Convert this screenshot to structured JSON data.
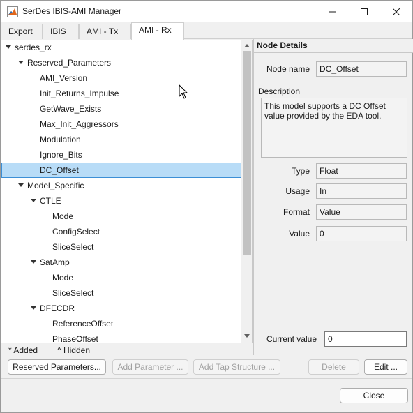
{
  "window": {
    "title": "SerDes IBIS-AMI Manager"
  },
  "tabs": [
    {
      "label": "Export"
    },
    {
      "label": "IBIS"
    },
    {
      "label": "AMI - Tx"
    },
    {
      "label": "AMI - Rx"
    }
  ],
  "active_tab": "AMI - Rx",
  "tree": {
    "rows": [
      {
        "label": "serdes_rx"
      },
      {
        "label": "Reserved_Parameters"
      },
      {
        "label": "AMI_Version"
      },
      {
        "label": "Init_Returns_Impulse"
      },
      {
        "label": "GetWave_Exists"
      },
      {
        "label": "Max_Init_Aggressors"
      },
      {
        "label": "Modulation"
      },
      {
        "label": "Ignore_Bits"
      },
      {
        "label": "DC_Offset"
      },
      {
        "label": "Model_Specific"
      },
      {
        "label": "CTLE"
      },
      {
        "label": "Mode"
      },
      {
        "label": "ConfigSelect"
      },
      {
        "label": "SliceSelect"
      },
      {
        "label": "SatAmp"
      },
      {
        "label": "Mode"
      },
      {
        "label": "SliceSelect"
      },
      {
        "label": "DFECDR"
      },
      {
        "label": "ReferenceOffset"
      },
      {
        "label": "PhaseOffset"
      }
    ],
    "selected": "DC_Offset"
  },
  "details": {
    "header": "Node Details",
    "node_name_label": "Node name",
    "node_name": "DC_Offset",
    "description_label": "Description",
    "description": "This model supports a DC Offset value provided by the EDA tool.",
    "type_label": "Type",
    "type": "Float",
    "usage_label": "Usage",
    "usage": "In",
    "format_label": "Format",
    "format": "Value",
    "value_label": "Value",
    "value": "0",
    "current_value_label": "Current value",
    "current_value": "0"
  },
  "legend": {
    "added": "* Added",
    "hidden": "^ Hidden"
  },
  "buttons": {
    "reserved_parameters": "Reserved Parameters...",
    "add_parameter": "Add Parameter ...",
    "add_tap_structure": "Add Tap Structure ...",
    "delete": "Delete",
    "edit": "Edit ...",
    "close": "Close"
  },
  "icons": {
    "app": "matlab-icon",
    "minimize": "minimize-icon",
    "maximize": "maximize-icon",
    "close": "close-icon"
  },
  "colors": {
    "selection": "#b8dcf7",
    "selection_border": "#3c8fd6"
  }
}
